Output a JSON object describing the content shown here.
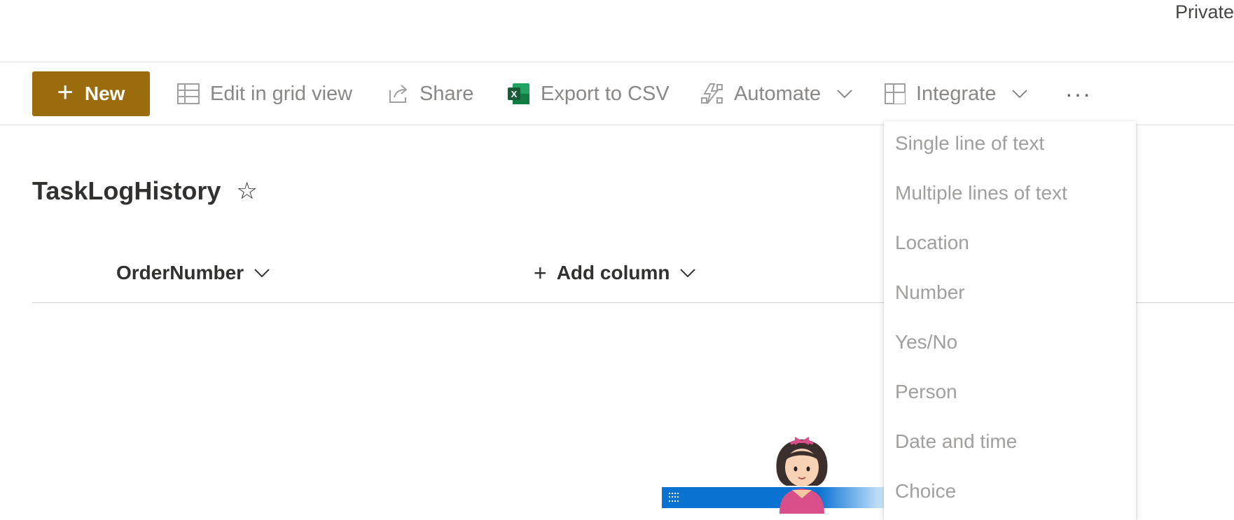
{
  "header": {
    "privacy_label": "Private"
  },
  "toolbar": {
    "new_label": "New",
    "edit_grid_label": "Edit in grid view",
    "share_label": "Share",
    "export_label": "Export to CSV",
    "automate_label": "Automate",
    "integrate_label": "Integrate",
    "more_label": "···"
  },
  "list": {
    "title": "TaskLogHistory"
  },
  "columns": {
    "order_number": "OrderNumber",
    "add_column": "Add column"
  },
  "column_type_menu": {
    "items": [
      "Single line of text",
      "Multiple lines of text",
      "Location",
      "Number",
      "Yes/No",
      "Person",
      "Date and time",
      "Choice"
    ]
  },
  "icons": {
    "new": "plus-icon",
    "grid": "grid-icon",
    "share": "share-icon",
    "excel": "excel-icon",
    "automate": "automate-icon",
    "integrate": "integrate-icon",
    "favorite": "star-icon",
    "chevron": "chevron-down-icon"
  },
  "colors": {
    "accent": "#9a6c0e",
    "taskbar": "#0a72d0",
    "muted_text": "#8a8886"
  }
}
